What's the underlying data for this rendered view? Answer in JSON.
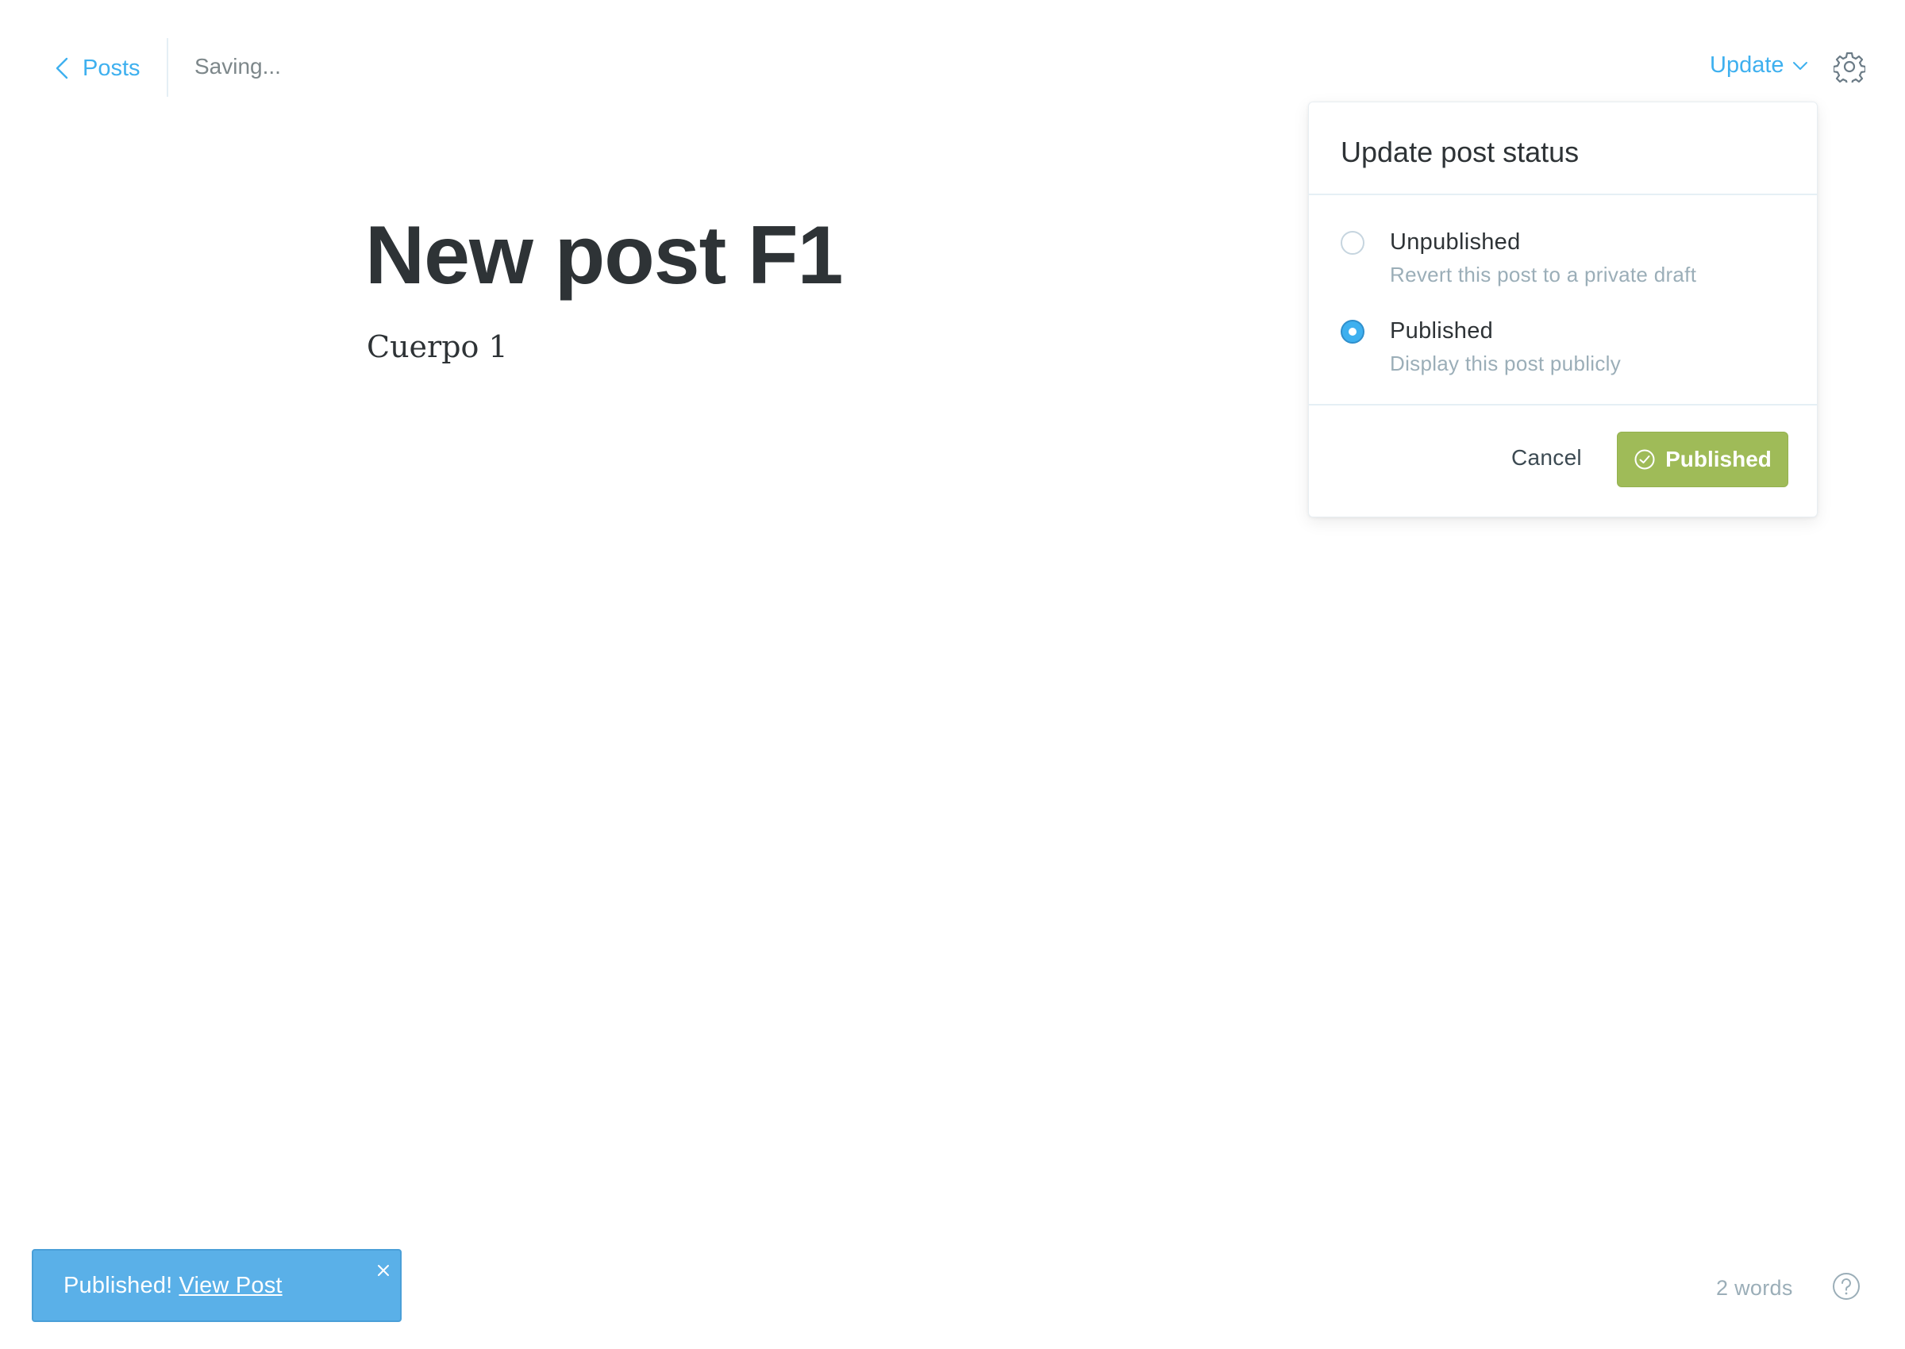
{
  "header": {
    "back_label": "Posts",
    "save_status": "Saving...",
    "update_label": "Update"
  },
  "editor": {
    "title": "New post F1",
    "body": "Cuerpo 1"
  },
  "popover": {
    "title": "Update post status",
    "options": [
      {
        "label": "Unpublished",
        "description": "Revert this post to a private draft",
        "selected": false
      },
      {
        "label": "Published",
        "description": "Display this post publicly",
        "selected": true
      }
    ],
    "cancel_label": "Cancel",
    "primary_label": "Published"
  },
  "toast": {
    "message": "Published!",
    "link_label": "View Post"
  },
  "footer": {
    "word_count": "2 words"
  },
  "colors": {
    "accent_blue": "#3eb0ef",
    "success_green": "#9fbb58",
    "toast_blue": "#5ab0e8",
    "text_dark": "#2e3336",
    "text_muted": "#9baeb8"
  },
  "icons": [
    "chevron-left-icon",
    "chevron-down-icon",
    "gear-icon",
    "check-circle-icon",
    "close-icon",
    "help-icon"
  ]
}
